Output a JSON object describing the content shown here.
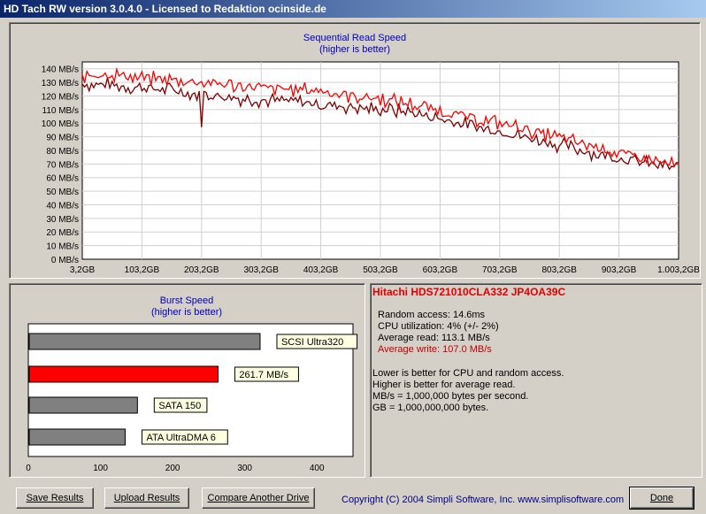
{
  "window": {
    "title": "HD Tach RW version 3.0.4.0 - Licensed to Redaktion ocinside.de"
  },
  "sequential_chart": {
    "title_line1": "Sequential Read Speed",
    "title_line2": "(higher is better)",
    "y_ticks": [
      "140 MB/s",
      "130 MB/s",
      "120 MB/s",
      "110 MB/s",
      "100 MB/s",
      "90 MB/s",
      "80 MB/s",
      "70 MB/s",
      "60 MB/s",
      "50 MB/s",
      "40 MB/s",
      "30 MB/s",
      "20 MB/s",
      "10 MB/s",
      "0 MB/s"
    ],
    "x_ticks": [
      "3,2GB",
      "103,2GB",
      "203,2GB",
      "303,2GB",
      "403,2GB",
      "503,2GB",
      "603,2GB",
      "703,2GB",
      "803,2GB",
      "903,2GB",
      "1.003,2GB"
    ]
  },
  "chart_data": [
    {
      "type": "line",
      "ylim": [
        0,
        145
      ],
      "xlim": [
        3.2,
        1003.2
      ],
      "x_unit": "GB",
      "y_unit": "MB/s",
      "x": [
        3.2,
        53.2,
        103.2,
        153.2,
        203.2,
        253.2,
        303.2,
        353.2,
        403.2,
        453.2,
        503.2,
        553.2,
        603.2,
        653.2,
        703.2,
        753.2,
        803.2,
        853.2,
        903.2,
        953.2,
        1003.2
      ],
      "series": [
        {
          "color": "#ff0000",
          "values": [
            135,
            136,
            133,
            132,
            130,
            128,
            126,
            125,
            124,
            120,
            118,
            114,
            109,
            104,
            100,
            95,
            89,
            84,
            78,
            73,
            68
          ]
        },
        {
          "color": "#800000",
          "values": [
            129,
            128,
            126,
            124,
            121,
            119,
            117,
            116,
            114,
            112,
            110,
            108,
            103,
            98,
            94,
            89,
            84,
            79,
            74,
            70,
            67
          ]
        }
      ],
      "dips": [
        {
          "x": 203.2,
          "value": 97
        }
      ]
    },
    {
      "type": "bar",
      "title": "Burst Speed",
      "subtitle": "(higher is better)",
      "orientation": "horizontal",
      "xlim": [
        0,
        450
      ],
      "x_ticks": [
        "0",
        "100",
        "200",
        "300",
        "400"
      ],
      "bars": [
        {
          "label": "SCSI Ultra320",
          "value": 320,
          "color": "#808080"
        },
        {
          "label": "261.7 MB/s",
          "value": 261.7,
          "color": "#ff0000"
        },
        {
          "label": "SATA 150",
          "value": 150,
          "color": "#808080"
        },
        {
          "label": "ATA UltraDMA 6",
          "value": 133,
          "color": "#808080"
        }
      ]
    }
  ],
  "info": {
    "drive": "Hitachi HDS721010CLA332 JP4OA39C",
    "random_access": "Random access: 14.6ms",
    "cpu": "CPU utilization: 4% (+/- 2%)",
    "avg_read": "Average read: 113.1 MB/s",
    "avg_write": "Average write: 107.0 MB/s",
    "note1": "Lower is better for CPU and random access.",
    "note2": "Higher is better for average read.",
    "note3": "MB/s = 1,000,000 bytes per second.",
    "note4": "GB = 1,000,000,000 bytes.",
    "write_color": "#c00000"
  },
  "buttons": {
    "save": "Save Results",
    "upload": "Upload Results",
    "compare": "Compare Another Drive",
    "done": "Done"
  },
  "footer": {
    "copyright": "Copyright (C) 2004 Simpli Software, Inc. www.simplisoftware.com"
  }
}
